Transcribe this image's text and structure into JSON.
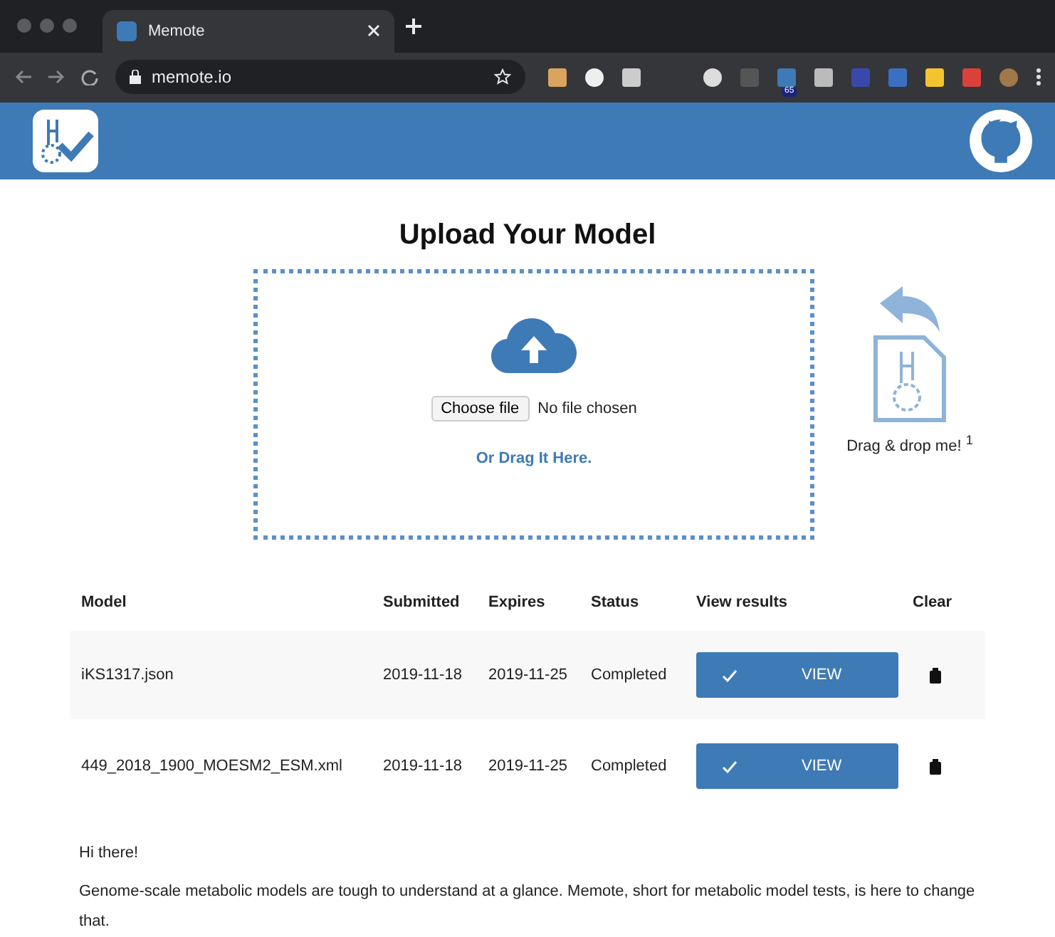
{
  "browser": {
    "tab_title": "Memote",
    "url": "memote.io",
    "extension_badge": "65"
  },
  "upload": {
    "title": "Upload Your Model",
    "choose_button": "Choose file",
    "file_status": "No file chosen",
    "drag_link": "Or Drag It Here.",
    "drag_hint": "Drag & drop me! $^{1}$"
  },
  "table": {
    "columns": [
      "Model",
      "Submitted",
      "Expires",
      "Status",
      "View results",
      "Clear"
    ],
    "rows": [
      {
        "model": "iKS1317.json",
        "submitted": "2019-11-18",
        "expires": "2019-11-25",
        "status": "Completed",
        "button": "VIEW"
      },
      {
        "model": "449_2018_1900_MOESM2_ESM.xml",
        "submitted": "2019-11-18",
        "expires": "2019-11-25",
        "status": "Completed",
        "button": "VIEW"
      }
    ]
  },
  "intro": [
    "Hi there!",
    "Genome-scale metabolic models are tough to understand at a glance. Memote, short for metabolic model tests, is here to change that."
  ]
}
